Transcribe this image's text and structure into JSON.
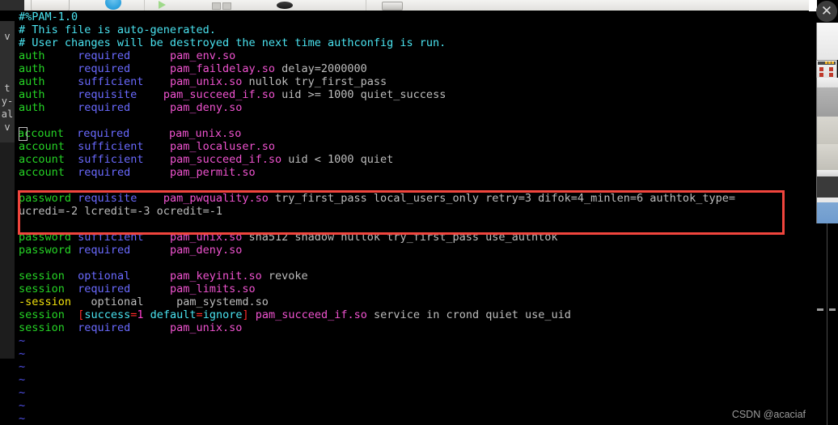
{
  "window": {
    "close_label": "✕",
    "watermark": "CSDN @acaciaf"
  },
  "left_background_window": {
    "chars": [
      "v",
      "t",
      "y-",
      "al",
      "v"
    ]
  },
  "editor": {
    "file_header": "#%PAM-1.0",
    "cursor_line": 10,
    "lines": [
      {
        "kind": "comment",
        "text": "#%PAM-1.0"
      },
      {
        "kind": "comment",
        "text": "# This file is auto-generated."
      },
      {
        "kind": "comment",
        "text": "# User changes will be destroyed the next time authconfig is run."
      },
      {
        "kind": "rule",
        "type": "auth",
        "control": "required",
        "module": "pam_env.so",
        "args": ""
      },
      {
        "kind": "rule",
        "type": "auth",
        "control": "required",
        "module": "pam_faildelay.so",
        "args": " delay=2000000"
      },
      {
        "kind": "rule",
        "type": "auth",
        "control": "sufficient",
        "module": "pam_unix.so",
        "args": " nullok try_first_pass"
      },
      {
        "kind": "rule",
        "type": "auth",
        "control": "requisite",
        "module": "pam_succeed_if.so",
        "args": " uid >= 1000 quiet_success"
      },
      {
        "kind": "rule",
        "type": "auth",
        "control": "required",
        "module": "pam_deny.so",
        "args": ""
      },
      {
        "kind": "blank",
        "text": ""
      },
      {
        "kind": "rule",
        "type": "account",
        "control": "required",
        "module": "pam_unix.so",
        "args": "",
        "cursor": true
      },
      {
        "kind": "rule",
        "type": "account",
        "control": "sufficient",
        "module": "pam_localuser.so",
        "args": ""
      },
      {
        "kind": "rule",
        "type": "account",
        "control": "sufficient",
        "module": "pam_succeed_if.so",
        "args": " uid < 1000 quiet"
      },
      {
        "kind": "rule",
        "type": "account",
        "control": "required",
        "module": "pam_permit.so",
        "args": ""
      },
      {
        "kind": "blank",
        "text": ""
      },
      {
        "kind": "rule",
        "type": "password",
        "control": "requisite",
        "module": "pam_pwquality.so",
        "args": " try_first_pass local_users_only retry=3 difok=4_minlen=6 authtok_type=",
        "highlighted": true
      },
      {
        "kind": "wrap",
        "text": "ucredi=-2 lcredit=-3 ocredit=-1",
        "highlighted": true
      },
      {
        "kind": "rule",
        "type": "password",
        "control": "sufficient",
        "module": "pam_unix.so",
        "args": " sha512 shadow nullok try_first_pass use_authtok"
      },
      {
        "kind": "rule",
        "type": "password",
        "control": "required",
        "module": "pam_deny.so",
        "args": ""
      },
      {
        "kind": "blank",
        "text": ""
      },
      {
        "kind": "rule",
        "type": "session",
        "control": "optional",
        "module": "pam_keyinit.so",
        "args": " revoke"
      },
      {
        "kind": "rule",
        "type": "session",
        "control": "required",
        "module": "pam_limits.so",
        "args": ""
      },
      {
        "kind": "dashsession",
        "type": "-session",
        "control": "optional",
        "module": "pam_systemd.so",
        "args": ""
      },
      {
        "kind": "bracket",
        "type": "session",
        "bracket": "[success=1 default=ignore]",
        "module": "pam_succeed_if.so",
        "args": " service in crond quiet use_uid"
      },
      {
        "kind": "rule",
        "type": "session",
        "control": "required",
        "module": "pam_unix.so",
        "args": ""
      }
    ],
    "empty_markers": [
      "~",
      "~",
      "~",
      "~",
      "~",
      "~",
      "~"
    ],
    "bracket_tokens": {
      "open": "[",
      "k1": "success",
      "eq1": "=",
      "v1": "1",
      "k2": "default",
      "eq2": "=",
      "v2": "ignore",
      "close": "]"
    },
    "colors": {
      "comment": "#4ae3f0",
      "type": "#25d425",
      "control": "#6a6aff",
      "module": "#f053d0",
      "plain": "#bdbdbd",
      "dash_session": "#f2e20c",
      "bracket_punct": "#ff2a2a",
      "bracket_key": "#4ae3f0",
      "bracket_value": "#ff3fd0",
      "tilde": "#5050e8",
      "annotation_box": "#f0453d",
      "background": "#000000"
    }
  }
}
